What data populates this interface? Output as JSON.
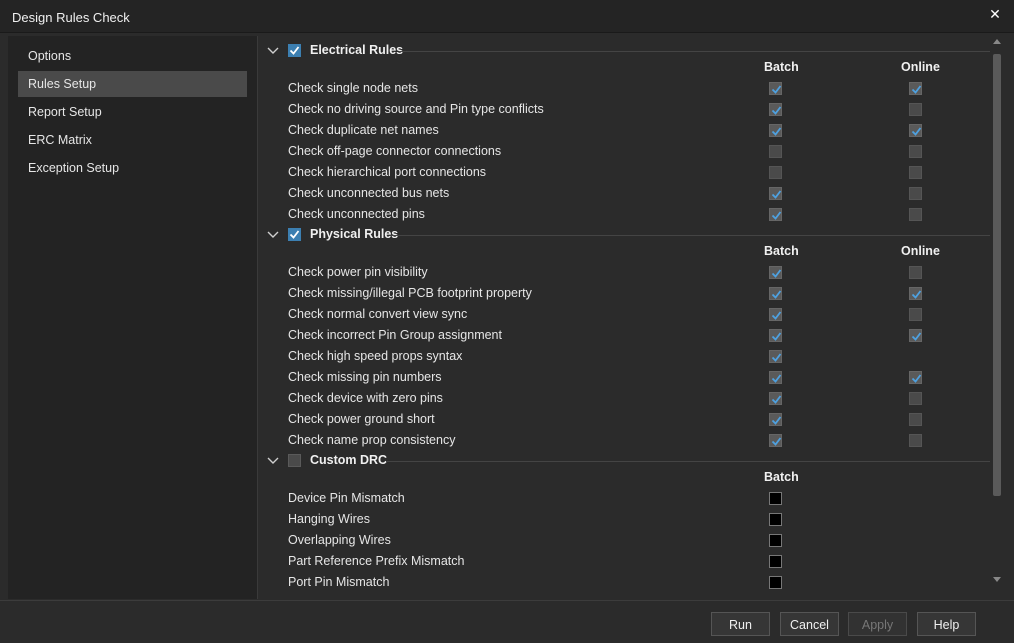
{
  "window": {
    "title": "Design Rules Check"
  },
  "sidebar": {
    "items": [
      {
        "label": "Options",
        "selected": false
      },
      {
        "label": "Rules Setup",
        "selected": true
      },
      {
        "label": "Report Setup",
        "selected": false
      },
      {
        "label": "ERC Matrix",
        "selected": false
      },
      {
        "label": "Exception Setup",
        "selected": false
      }
    ]
  },
  "columns": {
    "batch": "Batch",
    "online": "Online"
  },
  "sections": [
    {
      "title": "Electrical Rules",
      "enabled": true,
      "rows": [
        {
          "label": "Check single node nets",
          "batch": true,
          "online": true
        },
        {
          "label": "Check no driving source and Pin type conflicts",
          "batch": true,
          "online": false
        },
        {
          "label": "Check duplicate net names",
          "batch": true,
          "online": true
        },
        {
          "label": "Check off-page connector connections",
          "batch": false,
          "online": false
        },
        {
          "label": "Check hierarchical port connections",
          "batch": false,
          "online": false
        },
        {
          "label": "Check unconnected bus nets",
          "batch": true,
          "online": false
        },
        {
          "label": "Check unconnected pins",
          "batch": true,
          "online": false
        }
      ]
    },
    {
      "title": "Physical Rules",
      "enabled": true,
      "rows": [
        {
          "label": "Check power pin visibility",
          "batch": true,
          "online": false
        },
        {
          "label": "Check missing/illegal PCB footprint property",
          "batch": true,
          "online": true
        },
        {
          "label": "Check normal convert view sync",
          "batch": true,
          "online": false
        },
        {
          "label": "Check incorrect Pin Group assignment",
          "batch": true,
          "online": true
        },
        {
          "label": "Check high speed props syntax",
          "batch": true,
          "online": null
        },
        {
          "label": "Check missing pin numbers",
          "batch": true,
          "online": true
        },
        {
          "label": "Check device with zero pins",
          "batch": true,
          "online": false
        },
        {
          "label": "Check power ground short",
          "batch": true,
          "online": false
        },
        {
          "label": "Check name prop consistency",
          "batch": true,
          "online": false
        }
      ]
    },
    {
      "title": "Custom DRC",
      "enabled": false,
      "rows": [
        {
          "label": "Device Pin Mismatch",
          "batch": false
        },
        {
          "label": "Hanging Wires",
          "batch": false
        },
        {
          "label": "Overlapping Wires",
          "batch": false
        },
        {
          "label": "Part Reference Prefix Mismatch",
          "batch": false
        },
        {
          "label": "Port Pin Mismatch",
          "batch": false
        }
      ]
    }
  ],
  "footer": {
    "run": "Run",
    "cancel": "Cancel",
    "apply": "Apply",
    "help": "Help"
  },
  "icons": {
    "close": "close-icon",
    "expand": "chevron-down-icon",
    "check": "checkmark-icon"
  },
  "colors": {
    "accent": "#3c7fb1",
    "tick": "#4ea1e0",
    "background": "#2b2b2b"
  }
}
